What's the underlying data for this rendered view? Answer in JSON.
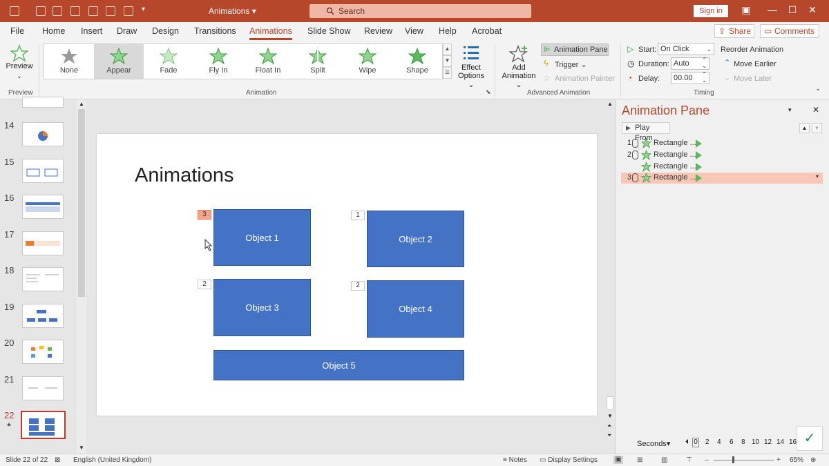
{
  "app": {
    "title": "Animations",
    "search_placeholder": "Search",
    "sign_in": "Sign in"
  },
  "tabs": [
    "File",
    "Home",
    "Insert",
    "Draw",
    "Design",
    "Transitions",
    "Animations",
    "Slide Show",
    "Review",
    "View",
    "Help",
    "Acrobat"
  ],
  "active_tab": "Animations",
  "share": "Share",
  "comments": "Comments",
  "ribbon": {
    "preview": "Preview",
    "preview_group": "Preview",
    "animation_group": "Animation",
    "gallery": [
      "None",
      "Appear",
      "Fade",
      "Fly In",
      "Float In",
      "Split",
      "Wipe",
      "Shape"
    ],
    "selected_effect": "Appear",
    "effect_options": [
      "Effect",
      "Options"
    ],
    "add_animation": [
      "Add",
      "Animation"
    ],
    "advanced_group": "Advanced Animation",
    "animation_pane": "Animation Pane",
    "trigger": "Trigger",
    "animation_painter": "Animation Painter",
    "timing_group": "Timing",
    "start_label": "Start:",
    "start_value": "On Click",
    "duration_label": "Duration:",
    "duration_value": "Auto",
    "delay_label": "Delay:",
    "delay_value": "00.00",
    "reorder": "Reorder Animation",
    "move_earlier": "Move Earlier",
    "move_later": "Move Later"
  },
  "thumbnails": [
    {
      "num": "14"
    },
    {
      "num": "15"
    },
    {
      "num": "16"
    },
    {
      "num": "17"
    },
    {
      "num": "18"
    },
    {
      "num": "19"
    },
    {
      "num": "20"
    },
    {
      "num": "21"
    },
    {
      "num": "22"
    }
  ],
  "slide": {
    "title": "Animations",
    "objects": [
      "Object 1",
      "Object 2",
      "Object 3",
      "Object 4",
      "Object 5"
    ],
    "tags": [
      "3",
      "1",
      "2",
      "2"
    ]
  },
  "pane": {
    "title": "Animation Pane",
    "play_from": "Play From",
    "items": [
      {
        "num": "1",
        "name": "Rectangle ..."
      },
      {
        "num": "2",
        "name": "Rectangle ..."
      },
      {
        "num": "",
        "name": "Rectangle ..."
      },
      {
        "num": "3",
        "name": "Rectangle ..."
      }
    ],
    "seconds": "Seconds",
    "ticks": [
      "0",
      "2",
      "4",
      "6",
      "8",
      "10",
      "12",
      "14",
      "16"
    ]
  },
  "status": {
    "slide_count": "Slide 22 of 22",
    "language": "English (United Kingdom)",
    "notes": "Notes",
    "display_settings": "Display Settings",
    "zoom": "65%"
  },
  "colors": {
    "accent": "#b7472a",
    "shape": "#4472c4",
    "selection": "#f8c7b6",
    "effect_star": "#5cb85c"
  }
}
